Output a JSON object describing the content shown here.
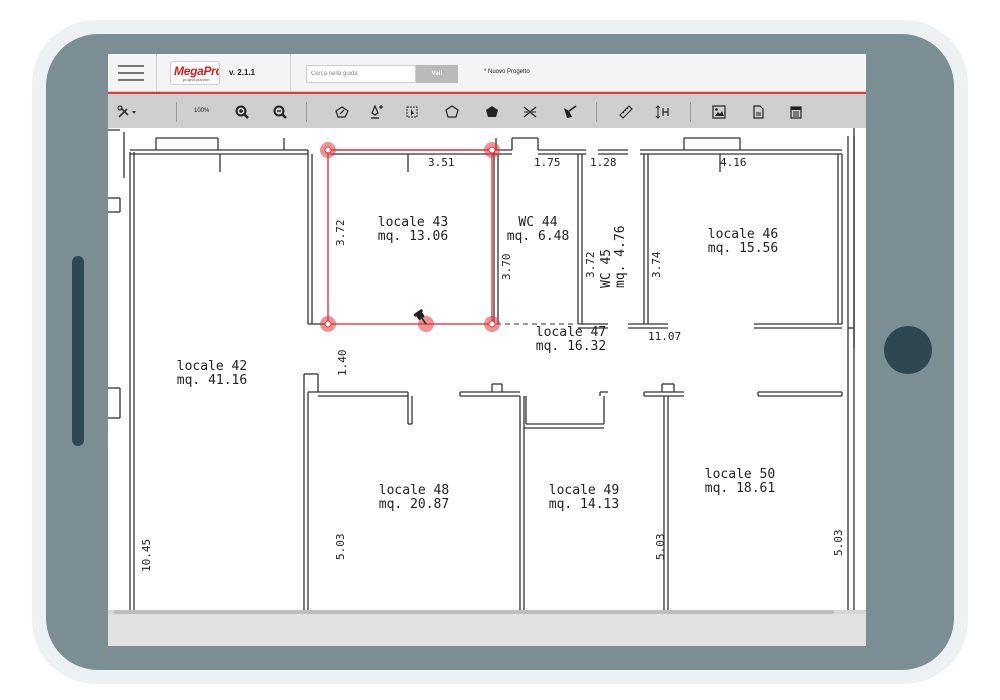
{
  "app": {
    "logo_text": "MegaPro",
    "logo_subtext": "project planner",
    "version": "v. 2.1.1",
    "project_title": "* Nuovo Progetto"
  },
  "search": {
    "placeholder": "Cerca nella guida",
    "button_label": "Vai!"
  },
  "toolbar": {
    "zoom_level": "100%",
    "tools": [
      "tools-icon",
      "zoom-in-icon",
      "zoom-out-icon",
      "draw-polygon-icon",
      "pen-add-icon",
      "select-area-icon",
      "pentagon-icon",
      "filled-pentagon-icon",
      "cut-icon",
      "eraser-icon",
      "ruler-icon",
      "height-icon",
      "image-icon",
      "document-icon",
      "calendar-icon"
    ]
  },
  "plan": {
    "rooms": [
      {
        "name": "locale 42",
        "area": "mq. 41.16"
      },
      {
        "name": "locale 43",
        "area": "mq. 13.06"
      },
      {
        "name": "WC 44",
        "area": "mq. 6.48"
      },
      {
        "name": "WC 45",
        "area": "mq. 4.76"
      },
      {
        "name": "locale 46",
        "area": "mq. 15.56"
      },
      {
        "name": "locale 47",
        "area": "mq. 16.32"
      },
      {
        "name": "locale 48",
        "area": "mq. 20.87"
      },
      {
        "name": "locale 49",
        "area": "mq. 14.13"
      },
      {
        "name": "locale 50",
        "area": "mq. 18.61"
      }
    ],
    "dimensions": {
      "d351": "3.51",
      "d175": "1.75",
      "d128": "1.28",
      "d416": "4.16",
      "d372a": "3.72",
      "d370": "3.70",
      "d372b": "3.72",
      "d374": "3.74",
      "d1107": "11.07",
      "d140": "1.40",
      "d1045": "10.45",
      "d503a": "5.03",
      "d503b": "5.03",
      "d503c": "5.03"
    }
  },
  "colors": {
    "accent": "#e23b3b",
    "selection": "#e0393e",
    "tablet": "#7b8e93",
    "tablet_dark": "#2f4750",
    "toolbar": "#cfcfcf"
  }
}
